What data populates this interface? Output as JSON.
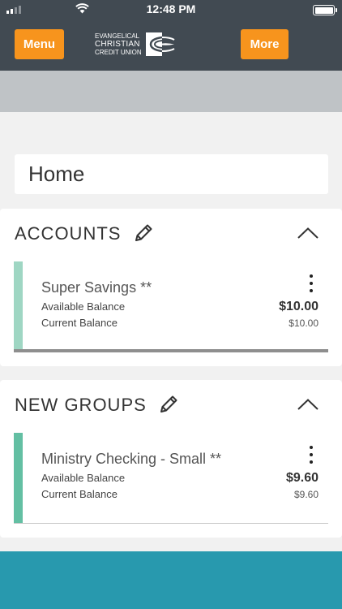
{
  "status_bar": {
    "time": "12:48 PM"
  },
  "header": {
    "menu_label": "Menu",
    "more_label": "More",
    "logo_line1": "Evangelical",
    "logo_line2": "Christian",
    "logo_line3": "Credit Union"
  },
  "page": {
    "title": "Home"
  },
  "sections": [
    {
      "title": "ACCOUNTS",
      "accounts": [
        {
          "name": "Super Savings **",
          "available_label": "Available Balance",
          "current_label": "Current Balance",
          "available_value": "$10.00",
          "current_value": "$10.00",
          "accent_color": "#9fd6c3"
        }
      ]
    },
    {
      "title": "NEW GROUPS",
      "accounts": [
        {
          "name": "Ministry Checking - Small **",
          "available_label": "Available Balance",
          "current_label": "Current Balance",
          "available_value": "$9.60",
          "current_value": "$9.60",
          "accent_color": "#63bfa3"
        }
      ]
    }
  ],
  "colors": {
    "header_bg": "#414a52",
    "button_orange": "#f7941d",
    "footer_teal": "#2899ae"
  },
  "icons": [
    "signal-icon",
    "wifi-icon",
    "battery-icon",
    "ecu-logo-icon",
    "pencil-icon",
    "chevron-up-icon",
    "kebab-menu-icon"
  ]
}
